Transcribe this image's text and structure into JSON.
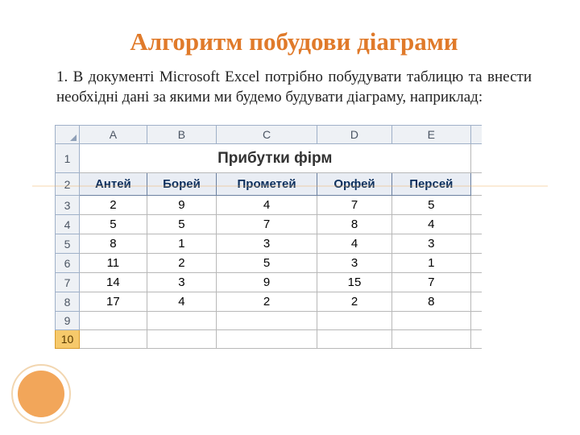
{
  "title": "Алгоритм побудови діаграми",
  "paragraph": "1. В документі Microsoft Excel потрібно побудувати таблицю та внести необхідні дані за якими ми будемо будувати діаграму, наприклад:",
  "sheet": {
    "columns": [
      "A",
      "B",
      "C",
      "D",
      "E"
    ],
    "table_title": "Прибутки фірм",
    "headers": [
      "Антей",
      "Борей",
      "Прометей",
      "Орфей",
      "Персей"
    ],
    "rows_data": [
      [
        "2",
        "9",
        "4",
        "7",
        "5"
      ],
      [
        "5",
        "5",
        "7",
        "8",
        "4"
      ],
      [
        "8",
        "1",
        "3",
        "4",
        "3"
      ],
      [
        "11",
        "2",
        "5",
        "3",
        "1"
      ],
      [
        "14",
        "3",
        "9",
        "15",
        "7"
      ],
      [
        "17",
        "4",
        "2",
        "2",
        "8"
      ]
    ],
    "row_numbers": [
      "1",
      "2",
      "3",
      "4",
      "5",
      "6",
      "7",
      "8",
      "9",
      "10"
    ],
    "selected_row": "10"
  },
  "chart_data": {
    "type": "table",
    "title": "Прибутки фірм",
    "categories": [
      "Антей",
      "Борей",
      "Прометей",
      "Орфей",
      "Персей"
    ],
    "series": [
      {
        "name": "row3",
        "values": [
          2,
          9,
          4,
          7,
          5
        ]
      },
      {
        "name": "row4",
        "values": [
          5,
          5,
          7,
          8,
          4
        ]
      },
      {
        "name": "row5",
        "values": [
          8,
          1,
          3,
          4,
          3
        ]
      },
      {
        "name": "row6",
        "values": [
          11,
          2,
          5,
          3,
          1
        ]
      },
      {
        "name": "row7",
        "values": [
          14,
          3,
          9,
          15,
          7
        ]
      },
      {
        "name": "row8",
        "values": [
          17,
          4,
          2,
          2,
          8
        ]
      }
    ],
    "xlabel": "",
    "ylabel": ""
  }
}
